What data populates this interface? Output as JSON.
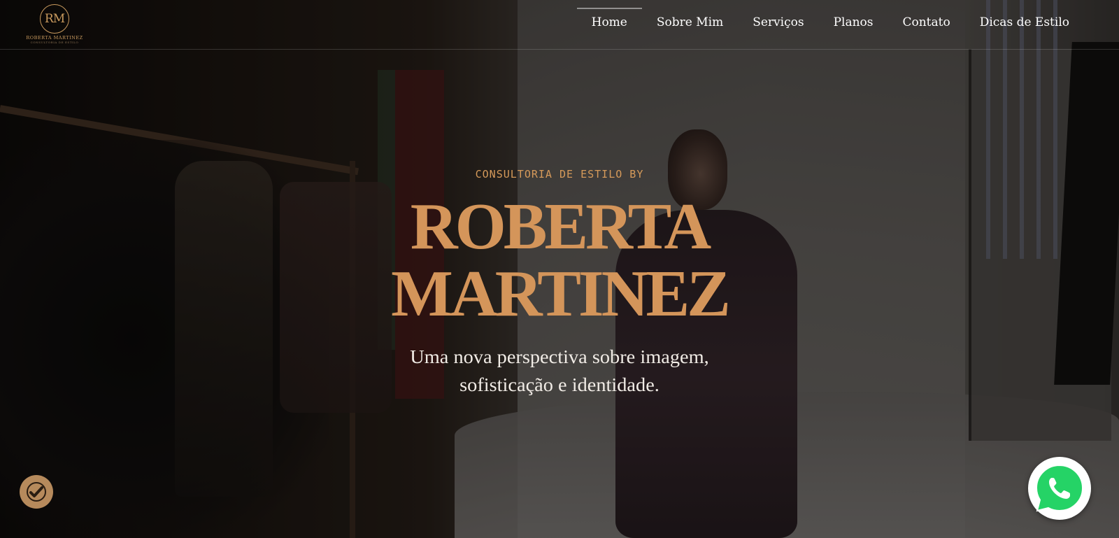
{
  "logo": {
    "monogram": "RM",
    "name": "ROBERTA MARTINEZ",
    "tagline": "CONSULTORIA DE ESTILO"
  },
  "nav": {
    "items": [
      {
        "label": "Home",
        "active": true
      },
      {
        "label": "Sobre Mim",
        "active": false
      },
      {
        "label": "Serviços",
        "active": false
      },
      {
        "label": "Planos",
        "active": false
      },
      {
        "label": "Contato",
        "active": false
      },
      {
        "label": "Dicas de Estilo",
        "active": false
      }
    ]
  },
  "hero": {
    "kicker": "CONSULTORIA DE ESTILO BY",
    "title_line1": "ROBERTA",
    "title_line2": "MARTINEZ",
    "subtitle_line1": "Uma nova perspectiva sobre imagem,",
    "subtitle_line2": "sofisticação e identidade."
  },
  "floating": {
    "accessibility_icon": "accessibility-icon",
    "whatsapp_icon": "whatsapp-icon"
  },
  "colors": {
    "accent_gold": "#d4955a",
    "whatsapp_green": "#25d366",
    "accessibility_bg": "#b68a5c"
  }
}
